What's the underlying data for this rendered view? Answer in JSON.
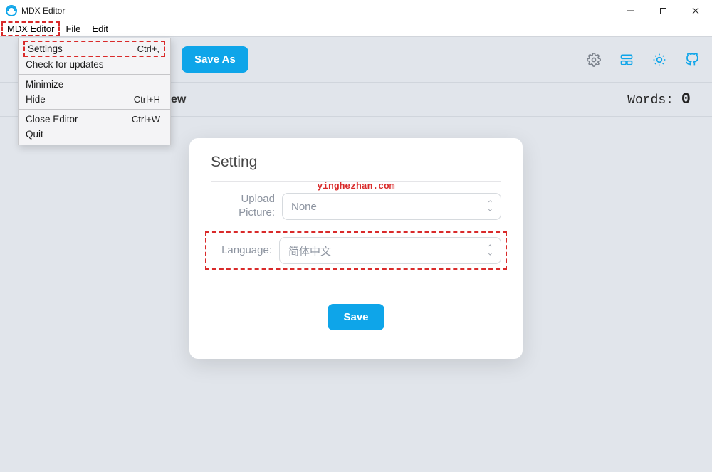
{
  "titlebar": {
    "title": "MDX Editor"
  },
  "menubar": {
    "items": [
      "MDX Editor",
      "File",
      "Edit"
    ]
  },
  "dropdown": {
    "groups": [
      [
        {
          "label": "Settings",
          "shortcut": "Ctrl+,",
          "highlighted": true
        },
        {
          "label": "Check for updates",
          "shortcut": ""
        }
      ],
      [
        {
          "label": "Minimize",
          "shortcut": ""
        },
        {
          "label": "Hide",
          "shortcut": "Ctrl+H"
        }
      ],
      [
        {
          "label": "Close Editor",
          "shortcut": "Ctrl+W"
        },
        {
          "label": "Quit",
          "shortcut": ""
        }
      ]
    ]
  },
  "toolbar": {
    "save_as_label": "Save As"
  },
  "statusbar": {
    "ew_suffix": "ew",
    "words_label": "Words:",
    "words_count": "0"
  },
  "watermark": "yinghezhan.com",
  "settings": {
    "title": "Setting",
    "upload_label": "Upload Picture:",
    "upload_value": "None",
    "language_label": "Language:",
    "language_value": "简体中文",
    "save_label": "Save"
  },
  "colors": {
    "accent": "#0ea5e9",
    "highlight_border": "#d92a2a",
    "bg": "#e1e5eb"
  }
}
